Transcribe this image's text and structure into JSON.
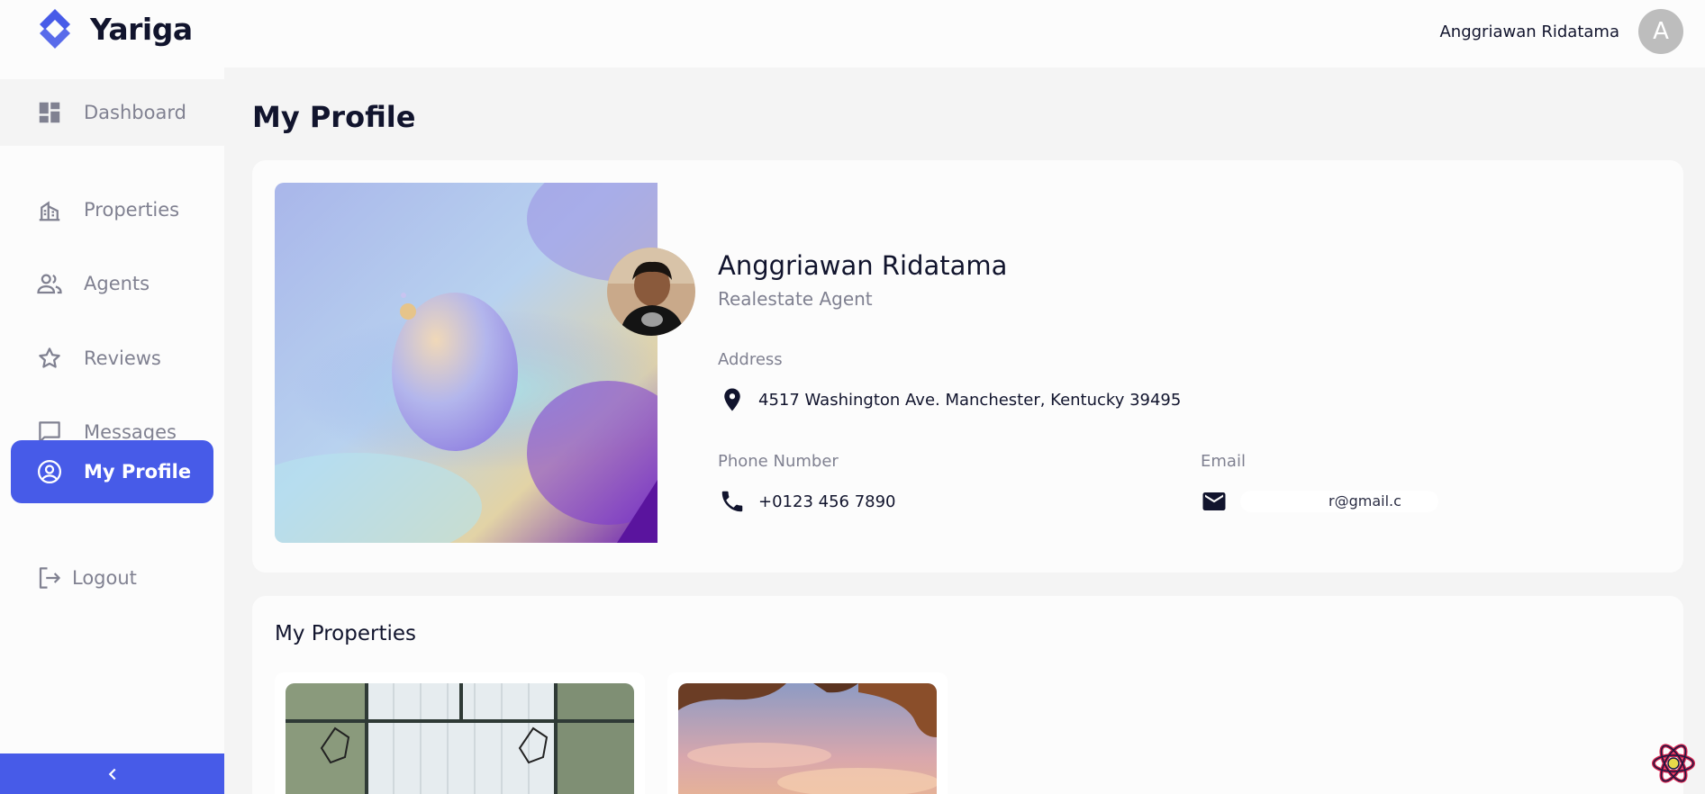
{
  "app": {
    "name": "Yariga"
  },
  "header": {
    "user_name": "Anggriawan Ridatama",
    "avatar_initial": "A"
  },
  "sidebar": {
    "items": [
      {
        "label": "Dashboard",
        "icon": "dashboard-icon"
      },
      {
        "label": "Properties",
        "icon": "properties-icon"
      },
      {
        "label": "Agents",
        "icon": "agents-icon"
      },
      {
        "label": "Reviews",
        "icon": "star-icon"
      },
      {
        "label": "Messages",
        "icon": "message-icon"
      },
      {
        "label": "My Profile",
        "icon": "account-circle-icon",
        "active": true
      },
      {
        "label": "Logout",
        "icon": "logout-icon"
      }
    ],
    "collapse_icon": "chevron-left-icon"
  },
  "page": {
    "title": "My Profile"
  },
  "profile": {
    "name": "Anggriawan Ridatama",
    "role": "Realestate Agent",
    "address_label": "Address",
    "address": "4517 Washington Ave. Manchester, Kentucky 39495",
    "phone_label": "Phone Number",
    "phone": "+0123 456 7890",
    "email_label": "Email",
    "email_visible": "r@gmail.c"
  },
  "properties": {
    "title": "My Properties"
  },
  "colors": {
    "accent": "#475be8",
    "text": "#11142d",
    "muted": "#808191"
  }
}
